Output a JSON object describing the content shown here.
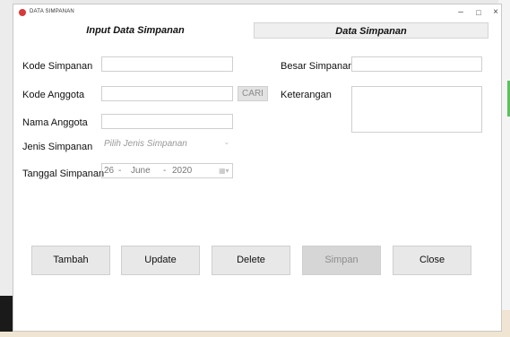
{
  "window": {
    "title": "DATA SIMPANAN",
    "controls": {
      "minimize": "–",
      "maximize": "□",
      "close": "×"
    }
  },
  "tabs": [
    {
      "label": "Input Data Simpanan",
      "selected": true
    },
    {
      "label": "Data Simpanan",
      "selected": false
    }
  ],
  "form": {
    "kode_simpanan": {
      "label": "Kode Simpanan",
      "value": ""
    },
    "kode_anggota": {
      "label": "Kode Anggota",
      "value": ""
    },
    "cari_button": "CARI",
    "nama_anggota": {
      "label": "Nama Anggota",
      "value": ""
    },
    "jenis_simpanan": {
      "label": "Jenis Simpanan",
      "selected": "Pilih Jenis Simpanan"
    },
    "tanggal_simpanan": {
      "label": "Tanggal Simpanan",
      "day": "26",
      "sep1": "-",
      "month": "June",
      "sep2": "-",
      "year": "2020"
    },
    "besar_simpanan": {
      "label": "Besar Simpanan",
      "value": ""
    },
    "keterangan": {
      "label": "Keterangan",
      "value": ""
    }
  },
  "buttons": {
    "tambah": "Tambah",
    "update": "Update",
    "delete": "Delete",
    "simpan": "Simpan",
    "close": "Close"
  }
}
